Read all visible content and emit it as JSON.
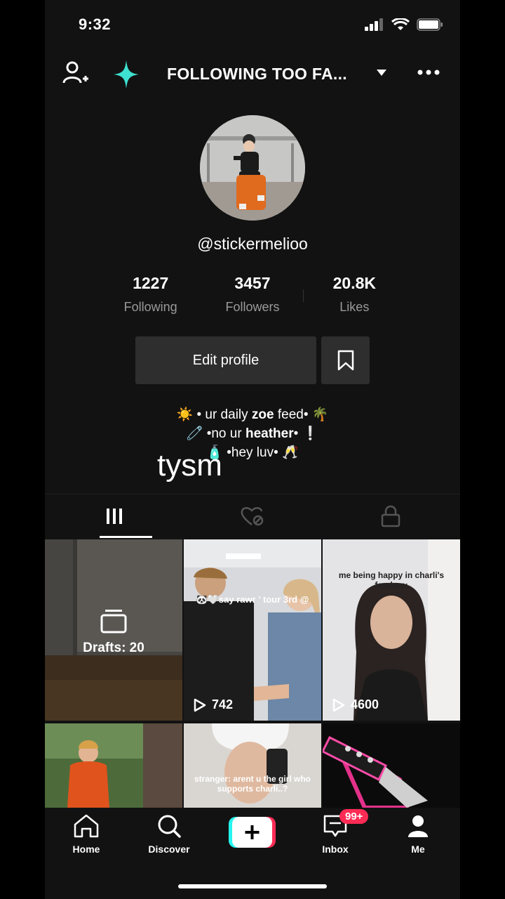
{
  "status_bar": {
    "time": "9:32"
  },
  "header": {
    "title": "FOLLOWING TOO FA..."
  },
  "profile": {
    "username": "@stickermelioo",
    "stats": [
      {
        "value": "1227",
        "label": "Following"
      },
      {
        "value": "3457",
        "label": "Followers"
      },
      {
        "value": "20.8K",
        "label": "Likes"
      }
    ],
    "edit_profile_label": "Edit profile",
    "bio": {
      "line1_pre": "☀️ • ur daily ",
      "line1_bold": "zoe",
      "line1_post": " feed• 🌴",
      "line2_pre": "🧷 •no ur ",
      "line2_bold": "heather",
      "line2_post": "• ❕",
      "line3": "🧴 •hey luv• 🥂"
    },
    "overlay_caption": "tysm"
  },
  "grid": {
    "drafts_label": "Drafts: 20",
    "videos": [
      {
        "views": "742",
        "caption": "🐼🤍say rawr ' tour 3rd @"
      },
      {
        "views": "4600",
        "caption": "me being happy in charli's fandom:"
      },
      {
        "views": "",
        "caption": ""
      },
      {
        "views": "",
        "caption": "stranger: arent u the girl who supports charli..?"
      },
      {
        "views": "",
        "caption": ""
      }
    ]
  },
  "navbar": {
    "items": [
      {
        "label": "Home",
        "icon": "home-icon"
      },
      {
        "label": "Discover",
        "icon": "search-icon"
      },
      {
        "label": "",
        "icon": "plus-icon"
      },
      {
        "label": "Inbox",
        "icon": "inbox-icon"
      },
      {
        "label": "Me",
        "icon": "profile-icon"
      }
    ],
    "inbox_badge": "99+"
  },
  "colors": {
    "accent": "#fe2c55",
    "sparkle": "#3ee0d0",
    "background": "#121212"
  }
}
